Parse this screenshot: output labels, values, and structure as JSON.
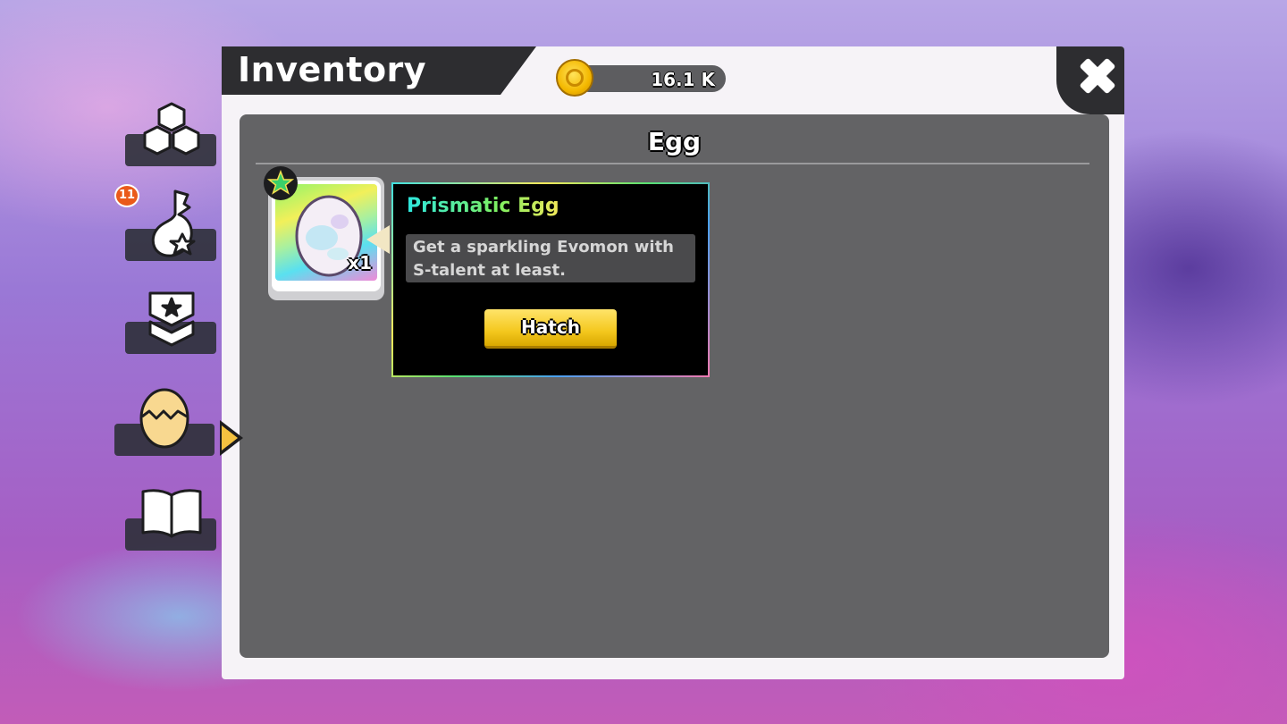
{
  "header": {
    "title": "Inventory"
  },
  "currency": {
    "amount": "16.1 K",
    "icon": "coin-icon"
  },
  "close": {
    "icon": "close-icon"
  },
  "section": {
    "title": "Egg"
  },
  "sidebar": {
    "items": [
      {
        "id": "items",
        "icon": "cubes-icon"
      },
      {
        "id": "potions",
        "icon": "potion-icon",
        "badge": "11"
      },
      {
        "id": "rank",
        "icon": "rank-chevron-icon"
      },
      {
        "id": "eggs",
        "icon": "egg-icon",
        "selected": true
      },
      {
        "id": "book",
        "icon": "book-icon"
      }
    ]
  },
  "inventory": {
    "items": [
      {
        "name": "Prismatic Egg",
        "count": "x1",
        "icon": "prismatic-egg-icon",
        "rarity_icon": "star-badge-icon"
      }
    ]
  },
  "tooltip": {
    "name": "Prismatic Egg",
    "description": "Get a sparkling Evomon with S-talent at least.",
    "action_label": "Hatch"
  },
  "colors": {
    "panel": "#f6f3f7",
    "content": "#636365",
    "tab": "#2d2d30",
    "hatch": "#f4c81e",
    "notif": "#ea5a1a"
  }
}
